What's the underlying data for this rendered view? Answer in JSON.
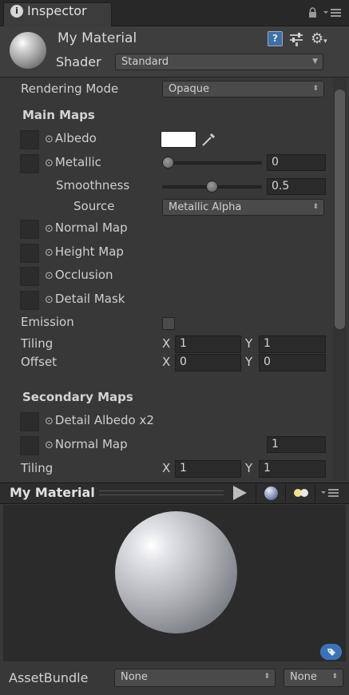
{
  "tab": {
    "title": "Inspector",
    "info_icon_glyph": "i"
  },
  "header": {
    "material_name": "My Material",
    "shader_label": "Shader",
    "shader_value": "Standard"
  },
  "properties": {
    "rendering_mode_label": "Rendering Mode",
    "rendering_mode_value": "Opaque",
    "main_maps_title": "Main Maps",
    "albedo_label": "Albedo",
    "albedo_color": "#ffffff",
    "metallic_label": "Metallic",
    "metallic_value": "0",
    "metallic_fraction": 0.0,
    "smoothness_label": "Smoothness",
    "smoothness_value": "0.5",
    "smoothness_fraction": 0.5,
    "source_label": "Source",
    "source_value": "Metallic Alpha",
    "normal_map_label": "Normal Map",
    "height_map_label": "Height Map",
    "occlusion_label": "Occlusion",
    "detail_mask_label": "Detail Mask",
    "emission_label": "Emission",
    "tiling_label": "Tiling",
    "tiling_x": "1",
    "tiling_y": "1",
    "offset_label": "Offset",
    "offset_x": "0",
    "offset_y": "0",
    "x_label": "X",
    "y_label": "Y",
    "secondary_maps_title": "Secondary Maps",
    "detail_albedo_label": "Detail Albedo x2",
    "secondary_normal_map_label": "Normal Map",
    "secondary_normal_value": "1",
    "secondary_tiling_label": "Tiling",
    "secondary_tiling_x": "1",
    "secondary_tiling_y": "1"
  },
  "preview": {
    "title": "My Material"
  },
  "bottom": {
    "assetbundle_label": "AssetBundle",
    "bundle_value": "None",
    "variant_value": "None"
  },
  "icons": {
    "info": "info-icon",
    "lock": "lock-icon",
    "menu": "tab-menu-icon",
    "help": "help-icon",
    "sliders": "sliders-icon",
    "gear": "gear-icon",
    "eyedropper": "eyedropper-icon",
    "play": "play-icon",
    "tag": "tag-icon"
  },
  "colors": {
    "accent": "#3b73b9",
    "panel": "#383838",
    "field": "#2a2a2a"
  }
}
